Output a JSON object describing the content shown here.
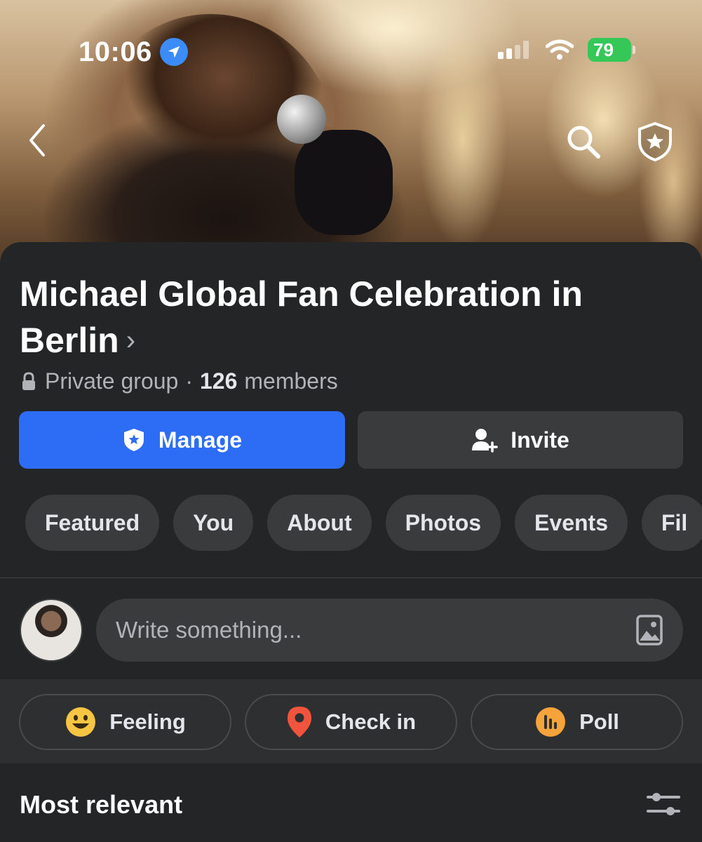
{
  "status_bar": {
    "time": "10:06",
    "battery": "79"
  },
  "header": {
    "back_icon": "chevron-left-icon",
    "search_icon": "search-icon",
    "admin_icon": "shield-star-icon"
  },
  "group": {
    "title": "Michael Global Fan Celebration in Berlin",
    "privacy": "Private group",
    "separator": "·",
    "member_count": "126",
    "member_label": "members"
  },
  "buttons": {
    "manage_label": "Manage",
    "invite_label": "Invite"
  },
  "tabs": [
    "Featured",
    "You",
    "About",
    "Photos",
    "Events",
    "Fil"
  ],
  "composer": {
    "placeholder": "Write something..."
  },
  "actions": {
    "feeling": "Feeling",
    "check_in": "Check in",
    "poll": "Poll"
  },
  "feed": {
    "sort_label": "Most relevant"
  },
  "colors": {
    "background": "#242526",
    "accent": "#2d6cf5",
    "chip": "#3a3b3c",
    "battery": "#36c759",
    "feeling": "#f7c544",
    "check_in": "#f0543c",
    "poll": "#f5a33b"
  }
}
